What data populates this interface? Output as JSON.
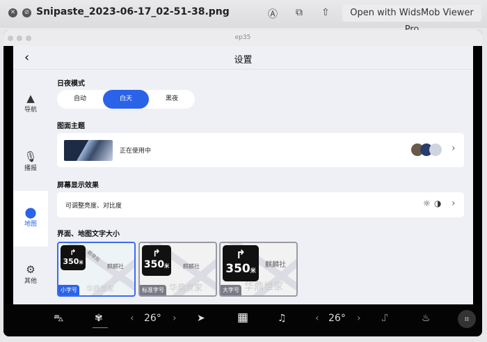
{
  "viewer": {
    "filename": "Snipaste_2023-06-17_02-51-38.png",
    "open_with": "Open with WidsMob Viewer Pro",
    "icons": [
      "close-icon",
      "minimize-icon",
      "markup-icon",
      "rotate-icon",
      "share-icon"
    ]
  },
  "window": {
    "title": "ep35"
  },
  "app": {
    "title": "设置",
    "back": "‹"
  },
  "sidebar": [
    {
      "label": "导航",
      "icon": "▲"
    },
    {
      "label": "播报",
      "icon": "🎙"
    },
    {
      "label": "地图",
      "icon": "⬤"
    },
    {
      "label": "其他",
      "icon": "⚙"
    }
  ],
  "day_night": {
    "title": "日夜模式",
    "options": [
      "自动",
      "白天",
      "黑夜"
    ],
    "selected": "白天"
  },
  "theme": {
    "title": "图面主题",
    "status": "正在使用中",
    "chevron": "›"
  },
  "display": {
    "title": "屏幕显示效果",
    "desc": "可调整亮度、对比度",
    "chevron": "›"
  },
  "text_size": {
    "title": "界面、地图文字大小",
    "distance": "350",
    "unit": "米",
    "poi": "麒麟社",
    "estate": "华鼎世家",
    "street": "碧泉街",
    "options": [
      "小字号",
      "标准字号",
      "大字号"
    ],
    "selected": "小字号"
  },
  "dock": {
    "temp_left": "26°",
    "temp_right": "26°",
    "prev": "‹",
    "next": "›"
  },
  "accent": "#2a63e8"
}
